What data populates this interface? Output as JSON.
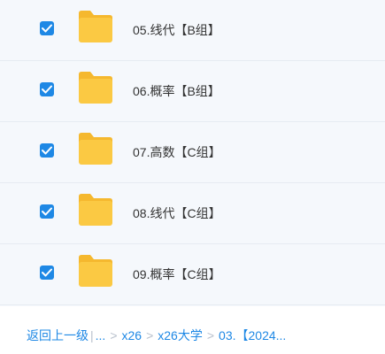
{
  "file_list": {
    "rows": [
      {
        "name": "05.线代【B组】",
        "checked": true
      },
      {
        "name": "06.概率【B组】",
        "checked": true
      },
      {
        "name": "07.高数【C组】",
        "checked": true
      },
      {
        "name": "08.线代【C组】",
        "checked": true
      },
      {
        "name": "09.概率【C组】",
        "checked": true
      }
    ]
  },
  "breadcrumb": {
    "back_label": "返回上一级",
    "pipe": "|",
    "ellipsis": "...",
    "separator": ">",
    "items": [
      "x26",
      "x26大学",
      "03.【2024..."
    ]
  },
  "colors": {
    "accent": "#1e88e5",
    "folder": "#fbc943",
    "folder_tab": "#f5b82e",
    "list_background": "#f5f8fc",
    "text": "#333333"
  }
}
